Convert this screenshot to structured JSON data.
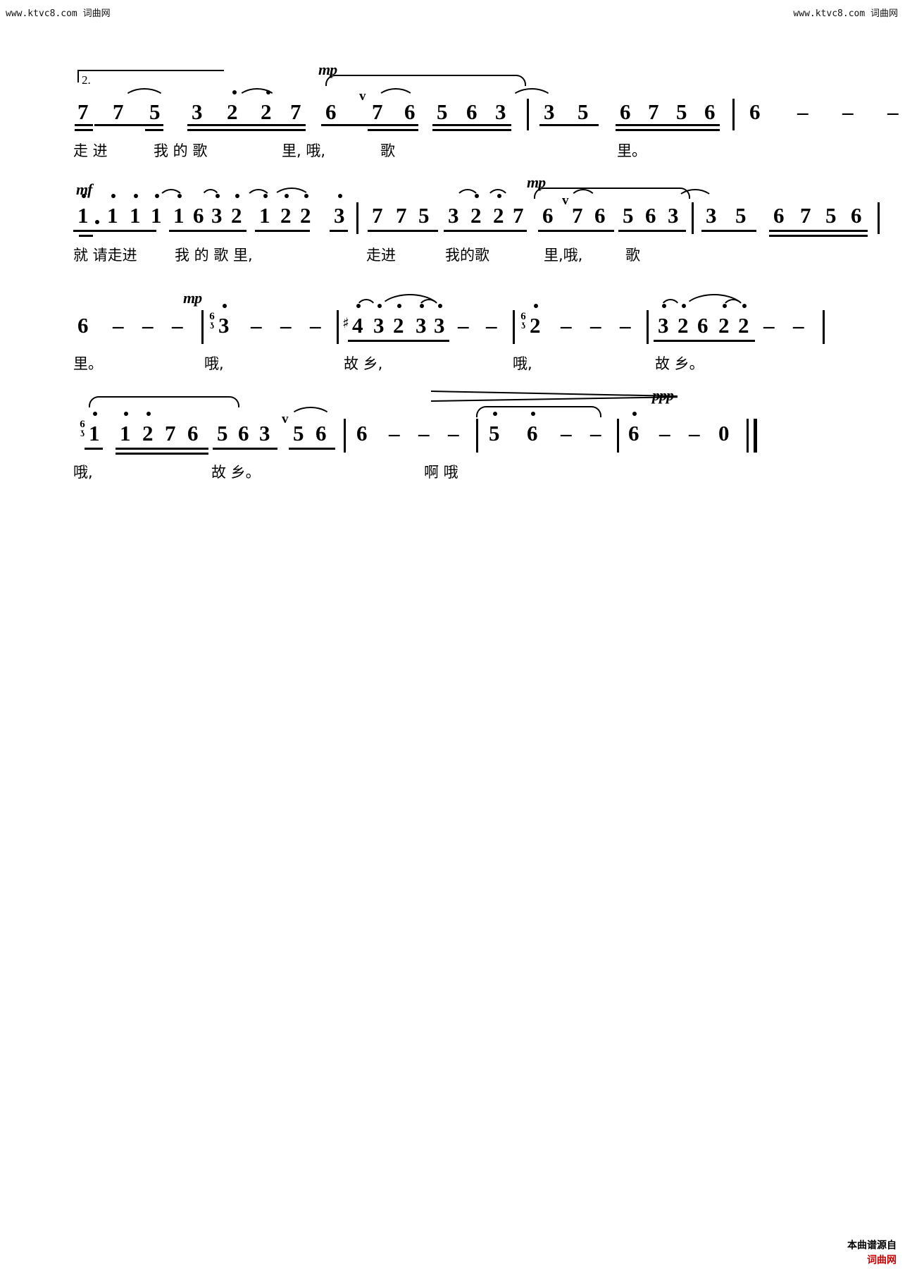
{
  "header": {
    "watermark_left": "www.ktvc8.com 词曲网",
    "watermark_right": "www.ktvc8.com 词曲网"
  },
  "footer": {
    "line1": "本曲谱源自",
    "line2": "词曲网"
  },
  "score": {
    "notation_type": "jianpu",
    "volta": "2.",
    "systems": [
      {
        "id": "system-1",
        "dynamics": [
          "mp"
        ],
        "measures": [
          {
            "notes": [
              "7",
              "7",
              "5",
              "3",
              "2",
              "2",
              "7",
              "6",
              "7",
              "6",
              "5",
              "6",
              "3"
            ]
          },
          {
            "notes": [
              "3",
              "5",
              "6",
              "7",
              "5",
              "6"
            ]
          },
          {
            "notes": [
              "6",
              "-",
              "-",
              "-"
            ]
          }
        ],
        "lyrics": [
          "走 进",
          "我 的 歌",
          "里, 哦,",
          "歌",
          "里。"
        ]
      },
      {
        "id": "system-2",
        "dynamics": [
          "mf",
          "mp"
        ],
        "measures": [
          {
            "notes": [
              "1.",
              "1",
              "1",
              "1",
              "1",
              "6",
              "3",
              "2",
              "1",
              "2",
              "2",
              "3"
            ]
          },
          {
            "notes": [
              "7",
              "7",
              "5",
              "3",
              "2",
              "2",
              "7",
              "6",
              "7",
              "6",
              "5",
              "6",
              "3"
            ]
          },
          {
            "notes": [
              "3",
              "5",
              "6",
              "7",
              "5",
              "6"
            ]
          }
        ],
        "lyrics": [
          "就 请走进",
          "我 的 歌 里,",
          "走进",
          "我的歌",
          "里,哦,",
          "歌"
        ]
      },
      {
        "id": "system-3",
        "dynamics": [
          "mp"
        ],
        "measures": [
          {
            "notes": [
              "6",
              "-",
              "-",
              "-"
            ]
          },
          {
            "notes": [
              "3",
              "-",
              "-",
              "-"
            ]
          },
          {
            "notes": [
              "#4",
              "3",
              "2",
              "3",
              "3",
              "-",
              "-"
            ]
          },
          {
            "notes": [
              "2",
              "-",
              "-",
              "-"
            ]
          },
          {
            "notes": [
              "3",
              "2",
              "6",
              "2",
              "2",
              "-",
              "-"
            ]
          }
        ],
        "lyrics": [
          "里。",
          "哦,",
          "故 乡,",
          "哦,",
          "故 乡。"
        ]
      },
      {
        "id": "system-4",
        "dynamics": [
          "ppp"
        ],
        "measures": [
          {
            "notes": [
              "1",
              "1",
              "2",
              "7",
              "6",
              "5",
              "6",
              "3",
              "5",
              "6"
            ]
          },
          {
            "notes": [
              "6",
              "-",
              "-",
              "-"
            ]
          },
          {
            "notes": [
              "5",
              "6",
              "-",
              "-"
            ]
          },
          {
            "notes": [
              "6",
              "-",
              "-",
              "0"
            ]
          }
        ],
        "lyrics": [
          "哦,",
          "故 乡。",
          "啊 哦"
        ]
      }
    ]
  }
}
